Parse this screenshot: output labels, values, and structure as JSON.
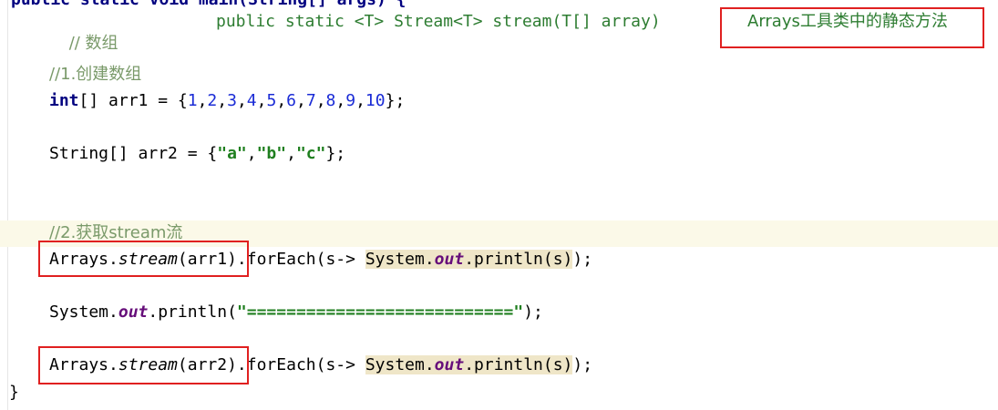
{
  "editor": {
    "line0": "public static void main(String[] args) {",
    "line1_comment": "// 数组",
    "line1_sig": "public static <T> Stream<T> stream(T[] array)",
    "line1_note": "Arrays工具类中的静态方法",
    "line2_comment": "//1.创建数组",
    "line3": {
      "kw": "int",
      "decl": "[] arr1 = {",
      "nums": [
        "1",
        "2",
        "3",
        "4",
        "5",
        "6",
        "7",
        "8",
        "9",
        "10"
      ],
      "end": "};"
    },
    "line4": {
      "decl": "String[] arr2 = {",
      "strs": [
        "\"a\"",
        "\"b\"",
        "\"c\""
      ],
      "end": "};"
    },
    "line5_comment": "//2.获取stream流",
    "line6": {
      "a": "Arrays.",
      "stream": "stream",
      "arg": "(arr1)",
      "each": ".forEach(s-> ",
      "sys": "System.",
      "out": "out",
      "pr": ".println(s)",
      "end": ");"
    },
    "line7": {
      "sys": "System.",
      "out": "out",
      "pr": ".println(",
      "str": "\"===========================\"",
      "end": ");"
    },
    "line8": {
      "a": "Arrays.",
      "stream": "stream",
      "arg": "(arr2)",
      "each": ".forEach(s-> ",
      "sys": "System.",
      "out": "out",
      "pr": ".println(s)",
      "end": ");"
    },
    "line9": "}"
  }
}
